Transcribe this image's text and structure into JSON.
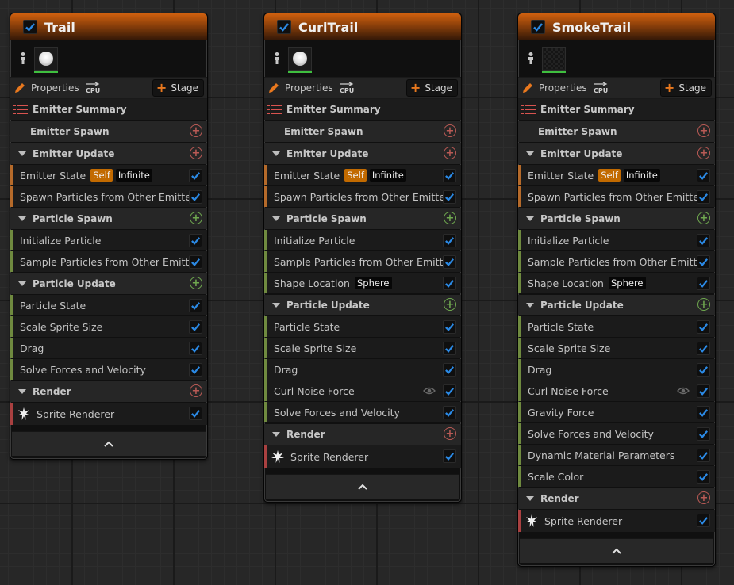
{
  "labels": {
    "properties": "Properties",
    "stage": "Stage",
    "emitter_summary": "Emitter Summary"
  },
  "trail": {
    "title": "Trail",
    "sections": {
      "emitter_spawn": "Emitter Spawn",
      "emitter_update": "Emitter Update",
      "particle_spawn": "Particle Spawn",
      "particle_update": "Particle Update",
      "render": "Render"
    },
    "emitter_update_items": [
      "Emitter State",
      "Spawn Particles from Other Emitter"
    ],
    "emitter_state_badges": [
      "Self",
      "Infinite"
    ],
    "particle_spawn_items": [
      "Initialize Particle",
      "Sample Particles from Other Emitter"
    ],
    "particle_update_items": [
      "Particle State",
      "Scale Sprite Size",
      "Drag",
      "Solve Forces and Velocity"
    ],
    "renderer": "Sprite Renderer"
  },
  "curltrail": {
    "title": "CurlTrail",
    "sections": {
      "emitter_spawn": "Emitter Spawn",
      "emitter_update": "Emitter Update",
      "particle_spawn": "Particle Spawn",
      "particle_update": "Particle Update",
      "render": "Render"
    },
    "emitter_update_items": [
      "Emitter State",
      "Spawn Particles from Other Emitter"
    ],
    "emitter_state_badges": [
      "Self",
      "Infinite"
    ],
    "particle_spawn_items": [
      "Initialize Particle",
      "Sample Particles from Other Emitter",
      "Shape Location"
    ],
    "shape_location_badge": "Sphere",
    "particle_update_items": [
      "Particle State",
      "Scale Sprite Size",
      "Drag",
      "Curl Noise Force",
      "Solve Forces and Velocity"
    ],
    "renderer": "Sprite Renderer"
  },
  "smoketrail": {
    "title": "SmokeTrail",
    "sections": {
      "emitter_spawn": "Emitter Spawn",
      "emitter_update": "Emitter Update",
      "particle_spawn": "Particle Spawn",
      "particle_update": "Particle Update",
      "render": "Render"
    },
    "emitter_update_items": [
      "Emitter State",
      "Spawn Particles from Other Emitter"
    ],
    "emitter_state_badges": [
      "Self",
      "Infinite"
    ],
    "particle_spawn_items": [
      "Initialize Particle",
      "Sample Particles from Other Emitter",
      "Shape Location"
    ],
    "shape_location_badge": "Sphere",
    "particle_update_items": [
      "Particle State",
      "Scale Sprite Size",
      "Drag",
      "Curl Noise Force",
      "Gravity Force",
      "Solve Forces and Velocity",
      "Dynamic Material Parameters",
      "Scale Color"
    ],
    "renderer": "Sprite Renderer"
  },
  "icons": [
    "checkbox-icon",
    "person-icon",
    "pencil-icon",
    "cpu-icon",
    "plus-icon",
    "list-icon",
    "chevron-down-icon",
    "circle-plus-icon",
    "eye-icon",
    "sprite-burst-icon",
    "chevron-up-icon"
  ],
  "colors": {
    "header_orange": "#d0600e",
    "accent_blue": "#2b8ae6",
    "spawn_green": "#6fa84f",
    "update_orange": "#b56a2a",
    "render_red": "#a94040",
    "self_badge": "#c26a00"
  }
}
